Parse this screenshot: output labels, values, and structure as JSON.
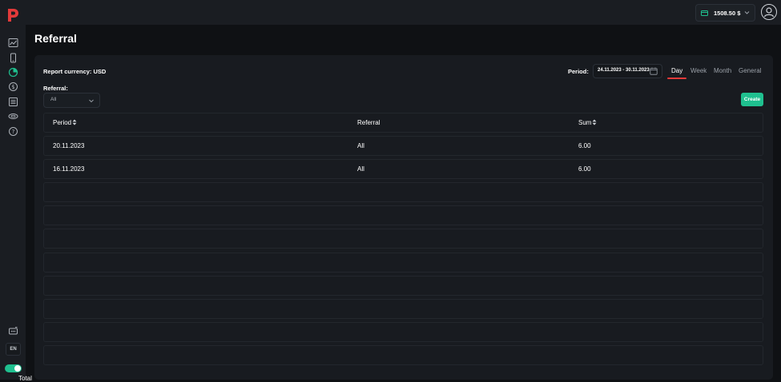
{
  "header": {
    "balance": "1508.50 $"
  },
  "sidebar": {
    "icons": [
      "chart-icon",
      "phone-icon",
      "pie-chart-icon",
      "dollar-icon",
      "list-icon",
      "layers-icon",
      "help-icon"
    ],
    "bottom_icon": "support-icon",
    "language": "EN"
  },
  "page": {
    "title": "Referral"
  },
  "report": {
    "currency_label": "Report currency: USD",
    "referral_label": "Referral:",
    "referral_value": "All",
    "period_label": "Period:",
    "date_range": "24.11.2023 - 30.11.2023",
    "tabs": [
      "Day",
      "Week",
      "Month",
      "General"
    ],
    "active_tab": "Day",
    "create_label": "Create"
  },
  "table": {
    "columns": [
      "Period",
      "Referral",
      "Sum"
    ],
    "rows": [
      [
        "20.11.2023",
        "All",
        "6.00"
      ],
      [
        "16.11.2023",
        "All",
        "6.00"
      ]
    ],
    "empty_rows": 8,
    "total_label": "Total"
  },
  "colors": {
    "accent_green": "#1fc08f",
    "accent_red": "#e23a3a",
    "background": "#0f1114",
    "panel": "#181b20"
  }
}
